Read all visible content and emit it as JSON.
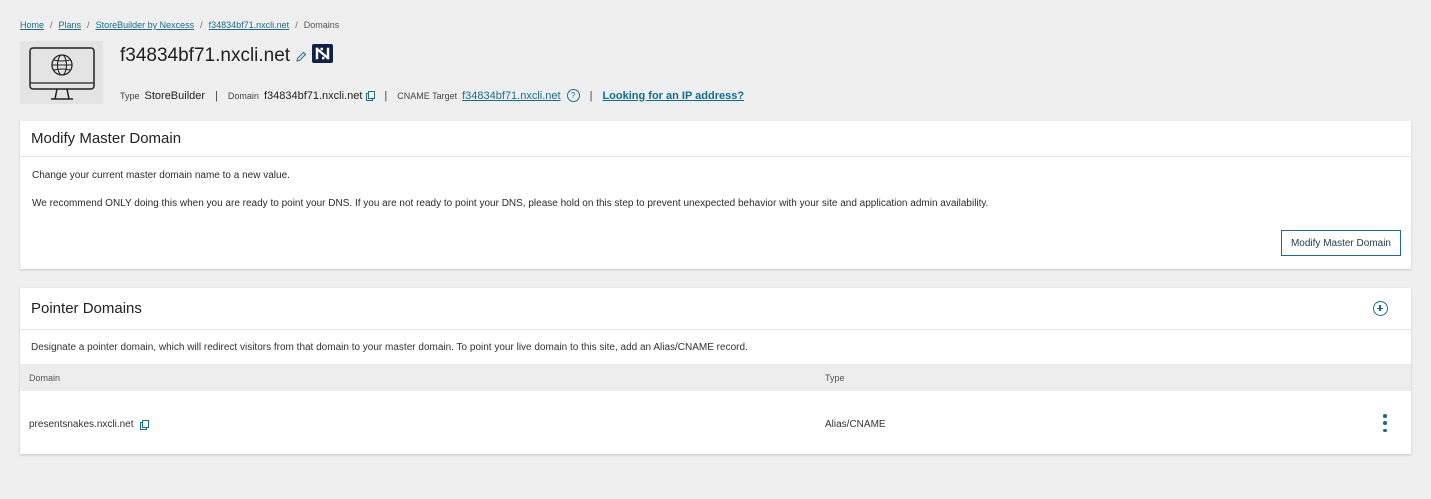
{
  "breadcrumb": {
    "home": "Home",
    "plans": "Plans",
    "plan": "StoreBuilder by Nexcess",
    "site": "f34834bf71.nxcli.net",
    "current": "Domains",
    "separator": "/"
  },
  "site": {
    "title": "f34834bf71.nxcli.net",
    "thumbnail_icon": "monitor-globe-icon",
    "brand_badge_icon": "nexcess-logo-icon",
    "type_label": "Type",
    "type_value": "StoreBuilder",
    "domain_label": "Domain",
    "domain_value": "f34834bf71.nxcli.net",
    "cname_label": "CNAME Target",
    "cname_value": "f34834bf71.nxcli.net",
    "help_glyph": "?",
    "ip_link": "Looking for an IP address?",
    "pipe": "|"
  },
  "modify_master": {
    "title": "Modify Master Domain",
    "line1": "Change your current master domain name to a new value.",
    "line2": "We recommend ONLY doing this when you are ready to point your DNS. If you are not ready to point your DNS, please hold on this step to prevent unexpected behavior with your site and application admin availability.",
    "button": "Modify Master Domain"
  },
  "pointer_domains": {
    "title": "Pointer Domains",
    "description": "Designate a pointer domain, which will redirect visitors from that domain to your master domain. To point your live domain to this site, add an Alias/CNAME record.",
    "columns": [
      "Domain",
      "Type"
    ],
    "rows": [
      {
        "domain": "presentsnakes.nxcli.net",
        "type": "Alias/CNAME"
      }
    ]
  },
  "colors": {
    "accent": "#1a6e8c",
    "page_bg": "#efefef",
    "badge_bg": "#0f2146"
  }
}
